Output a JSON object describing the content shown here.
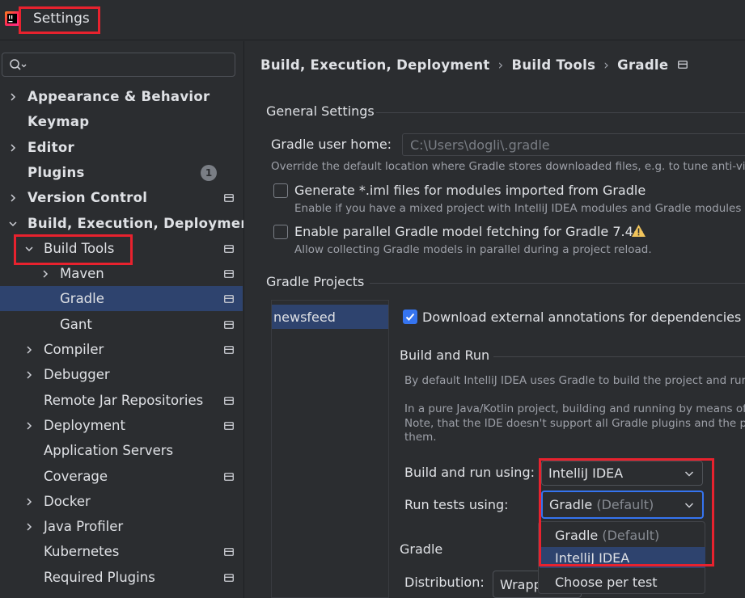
{
  "window": {
    "title": "Settings"
  },
  "search": {
    "placeholder": ""
  },
  "tree": {
    "items": [
      {
        "label": "Appearance & Behavior",
        "level": 0,
        "expandable": true,
        "expanded": false,
        "bold": true,
        "project": false
      },
      {
        "label": "Keymap",
        "level": 0,
        "expandable": false,
        "bold": true,
        "project": false
      },
      {
        "label": "Editor",
        "level": 0,
        "expandable": true,
        "expanded": false,
        "bold": true,
        "project": false
      },
      {
        "label": "Plugins",
        "level": 0,
        "expandable": false,
        "bold": true,
        "project": false,
        "badge": "1"
      },
      {
        "label": "Version Control",
        "level": 0,
        "expandable": true,
        "expanded": false,
        "bold": true,
        "project": true
      },
      {
        "label": "Build, Execution, Deployment",
        "level": 0,
        "expandable": true,
        "expanded": true,
        "bold": true,
        "project": false
      },
      {
        "label": "Build Tools",
        "level": 1,
        "expandable": true,
        "expanded": true,
        "bold": false,
        "project": true
      },
      {
        "label": "Maven",
        "level": 2,
        "expandable": true,
        "expanded": false,
        "bold": false,
        "project": true
      },
      {
        "label": "Gradle",
        "level": 2,
        "expandable": false,
        "bold": false,
        "project": true,
        "selected": true
      },
      {
        "label": "Gant",
        "level": 2,
        "expandable": false,
        "bold": false,
        "project": true
      },
      {
        "label": "Compiler",
        "level": 1,
        "expandable": true,
        "expanded": false,
        "bold": false,
        "project": true
      },
      {
        "label": "Debugger",
        "level": 1,
        "expandable": true,
        "expanded": false,
        "bold": false,
        "project": false
      },
      {
        "label": "Remote Jar Repositories",
        "level": 1,
        "expandable": false,
        "bold": false,
        "project": true
      },
      {
        "label": "Deployment",
        "level": 1,
        "expandable": true,
        "expanded": false,
        "bold": false,
        "project": true
      },
      {
        "label": "Application Servers",
        "level": 1,
        "expandable": false,
        "bold": false,
        "project": false
      },
      {
        "label": "Coverage",
        "level": 1,
        "expandable": false,
        "bold": false,
        "project": true
      },
      {
        "label": "Docker",
        "level": 1,
        "expandable": true,
        "expanded": false,
        "bold": false,
        "project": false
      },
      {
        "label": "Java Profiler",
        "level": 1,
        "expandable": true,
        "expanded": false,
        "bold": false,
        "project": false
      },
      {
        "label": "Kubernetes",
        "level": 1,
        "expandable": false,
        "bold": false,
        "project": true
      },
      {
        "label": "Required Plugins",
        "level": 1,
        "expandable": false,
        "bold": false,
        "project": true
      }
    ]
  },
  "breadcrumb": [
    "Build, Execution, Deployment",
    "Build Tools",
    "Gradle"
  ],
  "general": {
    "title": "General Settings",
    "user_home_label": "Gradle user home:",
    "user_home_value": "C:\\Users\\dogli\\.gradle",
    "user_home_hint": "Override the default location where Gradle stores downloaded files, e.g. to tune anti-virus",
    "iml_label": "Generate *.iml files for modules imported from Gradle",
    "iml_checked": false,
    "iml_hint": "Enable if you have a mixed project with IntelliJ IDEA modules and Gradle modules so t",
    "parallel_label": "Enable parallel Gradle model fetching for Gradle 7.4+",
    "parallel_checked": false,
    "parallel_hint": "Allow collecting Gradle models in parallel during a project reload."
  },
  "projects": {
    "title": "Gradle Projects",
    "list": [
      "newsfeed"
    ],
    "download_annotations_label": "Download external annotations for dependencies",
    "download_annotations_checked": true,
    "build_run_title": "Build and Run",
    "build_run_desc1": "By default IntelliJ IDEA uses Gradle to build the project and run th",
    "build_run_desc2": "In a pure Java/Kotlin project, building and running by means of th",
    "build_run_desc3": "Note, that the IDE doesn't support all Gradle plugins and the proje",
    "build_run_desc4": "them.",
    "build_using_label": "Build and run using:",
    "build_using_value": "IntelliJ IDEA",
    "tests_using_label": "Run tests using:",
    "tests_using_value": "Gradle",
    "tests_using_suffix": "(Default)",
    "dropdown_options": [
      {
        "label": "Gradle",
        "suffix": "(Default)",
        "selected": false
      },
      {
        "label": "IntelliJ IDEA",
        "suffix": "",
        "selected": true
      },
      {
        "label": "Choose per test",
        "suffix": "",
        "selected": false
      }
    ],
    "gradle_title": "Gradle",
    "distribution_label": "Distribution:",
    "distribution_value": "Wrapp"
  },
  "colors": {
    "background": "#2b2d30",
    "selection": "#2e436e",
    "accent": "#3574f0",
    "highlight_box": "#e8222e",
    "warning": "#f2c55c"
  }
}
